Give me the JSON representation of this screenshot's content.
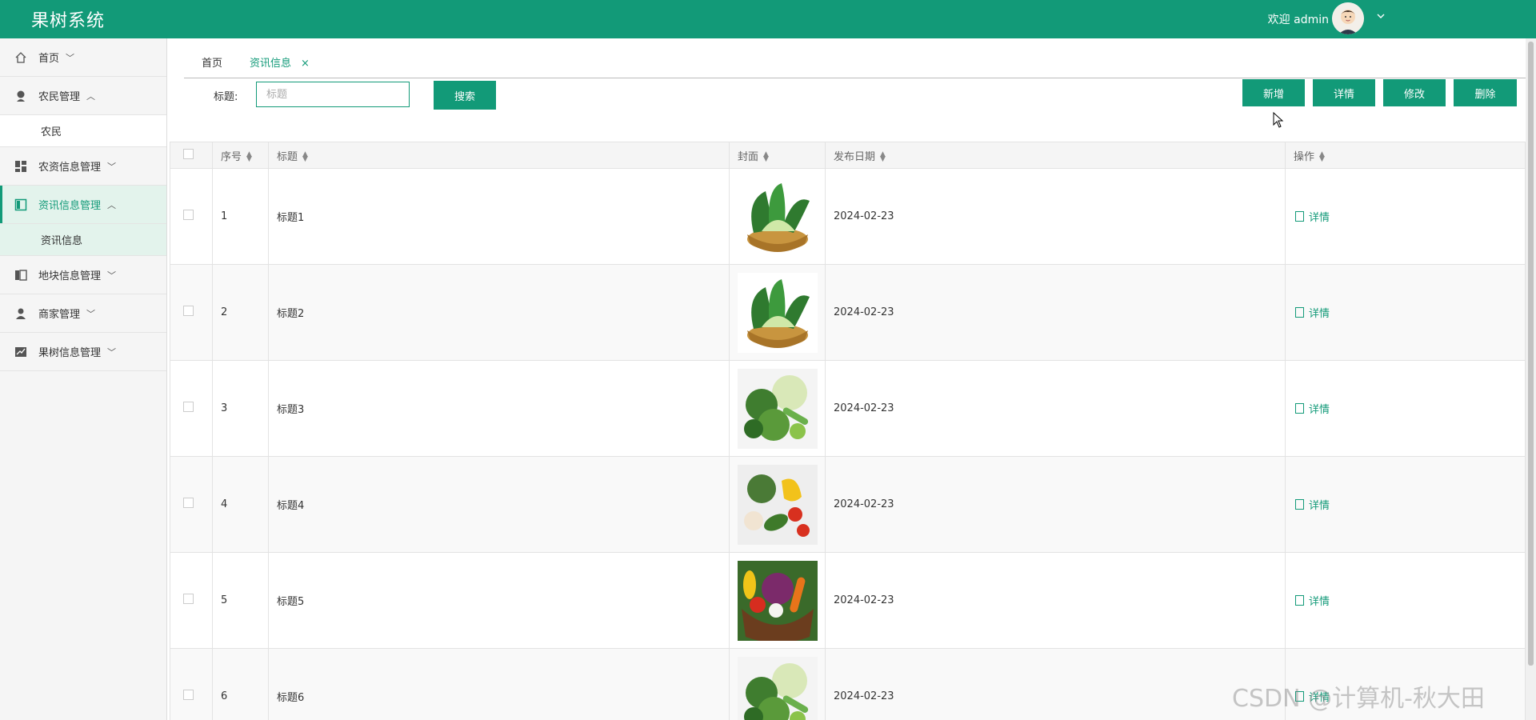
{
  "app": {
    "title": "果树系统",
    "welcome": "欢迎 admin",
    "brand_color": "#129a78"
  },
  "sidebar": {
    "items": [
      {
        "label": "首页",
        "icon": "home-icon"
      },
      {
        "label": "农民管理",
        "icon": "farmer-icon",
        "expanded": true,
        "sub": [
          "农民"
        ]
      },
      {
        "label": "农资信息管理",
        "icon": "dashboard-icon"
      },
      {
        "label": "资讯信息管理",
        "icon": "panel-icon",
        "expanded": true,
        "active": true,
        "sub": [
          "资讯信息"
        ]
      },
      {
        "label": "地块信息管理",
        "icon": "columns-icon"
      },
      {
        "label": "商家管理",
        "icon": "user-icon"
      },
      {
        "label": "果树信息管理",
        "icon": "chart-icon"
      }
    ]
  },
  "tabs": {
    "home": "首页",
    "current": "资讯信息",
    "close": "×"
  },
  "search": {
    "label": "标题:",
    "placeholder": "标题",
    "value": "",
    "button": "搜索"
  },
  "toolbar": {
    "add": "新增",
    "detail": "详情",
    "edit": "修改",
    "delete": "删除"
  },
  "table": {
    "columns": [
      "序号",
      "标题",
      "封面",
      "发布日期",
      "操作"
    ],
    "rows": [
      {
        "no": "1",
        "title": "标题1",
        "date": "2024-02-23",
        "op": "详情",
        "cover": "bok-choy-basket"
      },
      {
        "no": "2",
        "title": "标题2",
        "date": "2024-02-23",
        "op": "详情",
        "cover": "bok-choy-basket"
      },
      {
        "no": "3",
        "title": "标题3",
        "date": "2024-02-23",
        "op": "详情",
        "cover": "mixed-greens"
      },
      {
        "no": "4",
        "title": "标题4",
        "date": "2024-02-23",
        "op": "详情",
        "cover": "mixed-vegetables"
      },
      {
        "no": "5",
        "title": "标题5",
        "date": "2024-02-23",
        "op": "详情",
        "cover": "vegetable-basket"
      },
      {
        "no": "6",
        "title": "标题6",
        "date": "2024-02-23",
        "op": "详情",
        "cover": "mixed-greens"
      }
    ]
  },
  "watermark": "CSDN @计算机-秋大田"
}
